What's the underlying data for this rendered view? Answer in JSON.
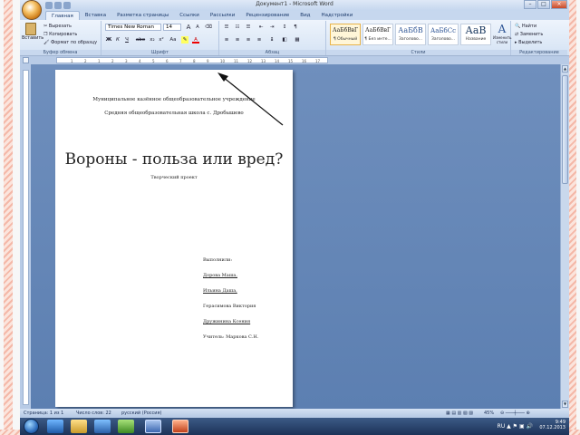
{
  "window": {
    "title": "Документ1 - Microsoft Word",
    "controls": {
      "minimize": "–",
      "maximize": "□",
      "close": "×"
    }
  },
  "ribbon_tabs": [
    {
      "label": "Главная",
      "active": true
    },
    {
      "label": "Вставка"
    },
    {
      "label": "Разметка страницы"
    },
    {
      "label": "Ссылки"
    },
    {
      "label": "Рассылки"
    },
    {
      "label": "Рецензирование"
    },
    {
      "label": "Вид"
    },
    {
      "label": "Надстройки"
    }
  ],
  "clipboard": {
    "paste": "Вставить",
    "cut": "Вырезать",
    "copy": "Копировать",
    "format_painter": "Формат по образцу",
    "group_label": "Буфер обмена"
  },
  "font": {
    "name": "Times New Roman",
    "size": "14",
    "group_label": "Шрифт",
    "bold": "Ж",
    "italic": "К",
    "underline": "Ч",
    "strike": "abe",
    "subscript": "x₂",
    "superscript": "x²",
    "case": "Aa",
    "grow": "A",
    "shrink": "A",
    "clear": "A"
  },
  "paragraph": {
    "group_label": "Абзац"
  },
  "styles": {
    "group_label": "Стили",
    "items": [
      {
        "sample": "АаБбВвГ",
        "name": "¶ Обычный",
        "selected": true
      },
      {
        "sample": "АаБбВвГ",
        "name": "¶ Без инте..."
      },
      {
        "sample": "АаБбВ",
        "name": "Заголово..."
      },
      {
        "sample": "АаБбСс",
        "name": "Заголово..."
      },
      {
        "sample": "АаВ",
        "name": "Название"
      }
    ],
    "change_styles": "Изменить стили"
  },
  "editing": {
    "group_label": "Редактирование",
    "find": "Найти",
    "replace": "Заменить",
    "select": "Выделить"
  },
  "ruler": {
    "ticks": [
      "1",
      "2",
      "1",
      "2",
      "3",
      "4",
      "5",
      "6",
      "7",
      "8",
      "9",
      "10",
      "11",
      "12",
      "13",
      "14",
      "15",
      "16",
      "17"
    ]
  },
  "document": {
    "org_line1": "Муниципальное казённое общеобразовательное учреждение",
    "org_line2": "Средняя общеобразовательная школа с. Дробышево",
    "title": "Вороны - польза или вред?",
    "subtitle": "Творческий проект",
    "author_lines": [
      {
        "text": "Выполнили:",
        "underline": false
      },
      {
        "text": "Дорова Маша,",
        "underline": true
      },
      {
        "text": "Ильина Даша,",
        "underline": true
      },
      {
        "text": "Герасимова Виктория",
        "underline": false
      },
      {
        "text": "Дружинина Ксения",
        "underline": true
      },
      {
        "text": "Учитель: Маркова С.Н.",
        "underline": false
      }
    ]
  },
  "status_bar": {
    "page": "Страница: 1 из 1",
    "words": "Число слов: 22",
    "language": "русский (Россия)",
    "zoom": "45%"
  },
  "taskbar": {
    "lang": "RU",
    "time": "9:49",
    "date": "07.12.2013"
  }
}
